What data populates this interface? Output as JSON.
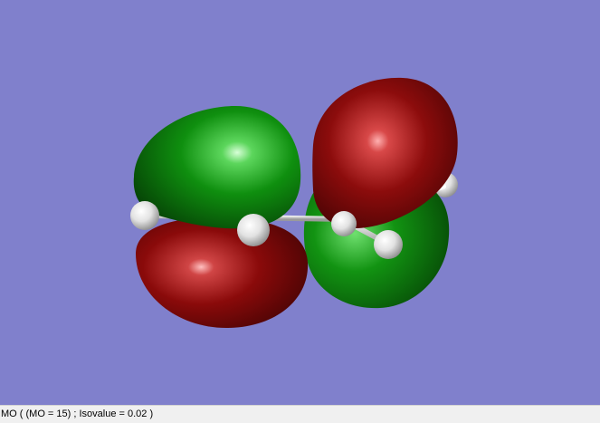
{
  "viewer": {
    "background_color": "#8080cc",
    "positive_lobe_color": "#0a8a0a",
    "negative_lobe_color": "#8a0a0a",
    "atom_color": "#f2f2f2"
  },
  "status": {
    "text": "MO ( (MO = 15) ; Isovalue = 0.02 )"
  }
}
